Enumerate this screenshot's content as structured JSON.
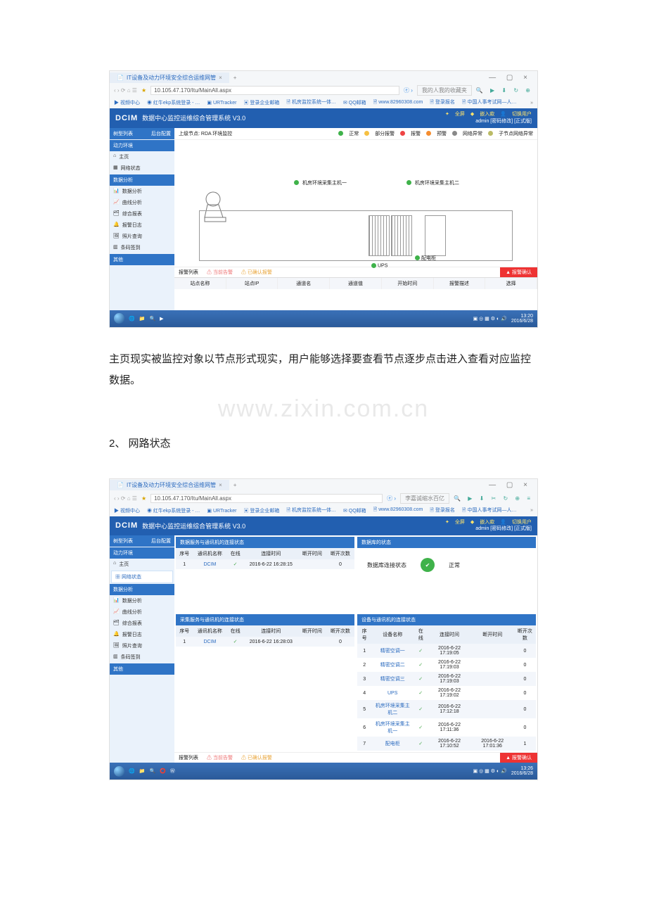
{
  "browser": {
    "tab_title": "IT设备及动力环境安全综合运维网管",
    "url": "10.105.47.170/Itu/MainAll.aspx",
    "search_hint1": "我的人我的收藏夹",
    "search_hint2": "李嘉诚缩水百亿",
    "bookmarks": [
      "视频中心",
      "红牛ekp系统登录 - …",
      "URTracker",
      "登录企业邮箱",
      "机房监控系统一体…",
      "QQ邮箱",
      "www.82960308.com",
      "登录报名",
      "中国人事考试网—人…"
    ]
  },
  "app": {
    "logo": "DCIM",
    "title": "数据中心监控运维综合管理系统  V3.0",
    "actions": {
      "fullscreen": "全屏",
      "embed": "嵌入款",
      "switch": "切换用户"
    },
    "userline": "admin   [密码修改]   [正式版]"
  },
  "sidebar": {
    "tabs": [
      "树型列表",
      "后台配置"
    ],
    "groups": [
      {
        "title": "动力环境",
        "items": [
          "主页",
          "网络状态"
        ]
      },
      {
        "title": "数据分析",
        "items": [
          "数据分析",
          "曲线分析",
          "综合报表",
          "报警日志",
          "照片查询",
          "条码签到"
        ]
      },
      {
        "title": "其他",
        "items": []
      }
    ]
  },
  "shot1": {
    "crumb": "上级节点: RDA 环境监控",
    "legend": [
      "正常",
      "部分报警",
      "报警",
      "预警",
      "网络异常",
      "子节点网络异常"
    ],
    "host1": "机房环境采集主机一",
    "host2": "机房环境采集主机二",
    "lab_ups": "UPS",
    "lab_pdc": "配电柜",
    "alarm_labels": [
      "报警列表",
      "当前告警",
      "已确认报警"
    ],
    "alarm_confirm": "报警确认",
    "cols": [
      "站点名称",
      "站点IP",
      "通道名",
      "通道值",
      "开始时间",
      "报警描述",
      "选择"
    ]
  },
  "para1": "主页现实被监控对象以节点形式现实，用户能够选择要查看节点逐步点击进入查看对应监控数据。",
  "watermark": "www.zixin.com.cn",
  "sec2": "2、  网路状态",
  "shot2": {
    "p1": {
      "title": "数据服务与通讯机的连接状态",
      "cols": [
        "序号",
        "通讯机名称",
        "在线",
        "连接时间",
        "断开时间",
        "断开次数"
      ],
      "row": [
        "1",
        "DCIM",
        "✓",
        "2016-6-22 16:28:15",
        "",
        "0"
      ]
    },
    "p2": {
      "title": "数据库的状态",
      "label": "数据库连接状态",
      "status": "正常"
    },
    "p3": {
      "title": "采集服务与通讯机的连接状态",
      "cols": [
        "序号",
        "通讯机名称",
        "在线",
        "连接时间",
        "断开时间",
        "断开次数"
      ],
      "row": [
        "1",
        "DCIM",
        "✓",
        "2016-6-22 16:28:03",
        "",
        "0"
      ]
    },
    "p4": {
      "title": "设备与通讯机的连接状态",
      "cols": [
        "序号",
        "设备名称",
        "在线",
        "连接时间",
        "断开时间",
        "断开次数"
      ],
      "rows": [
        [
          "1",
          "精密空调一",
          "✓",
          "2016-6-22 17:19:05",
          "",
          "0"
        ],
        [
          "2",
          "精密空调二",
          "✓",
          "2016-6-22 17:19:03",
          "",
          "0"
        ],
        [
          "3",
          "精密空调三",
          "✓",
          "2016-6-22 17:19:03",
          "",
          "0"
        ],
        [
          "4",
          "UPS",
          "✓",
          "2016-6-22 17:19:02",
          "",
          "0"
        ],
        [
          "5",
          "机房环境采集主机二",
          "✓",
          "2016-6-22 17:12:18",
          "",
          "0"
        ],
        [
          "6",
          "机房环境采集主机一",
          "✓",
          "2016-6-22 17:11:36",
          "",
          "0"
        ],
        [
          "7",
          "配电柜",
          "✓",
          "2016-6-22 17:10:52",
          "2016-6-22 17:01:36",
          "1"
        ]
      ]
    }
  },
  "taskbar": {
    "time1": "13:20",
    "date1": "2016/6/28",
    "time2": "13:26",
    "date2": "2016/6/28"
  }
}
